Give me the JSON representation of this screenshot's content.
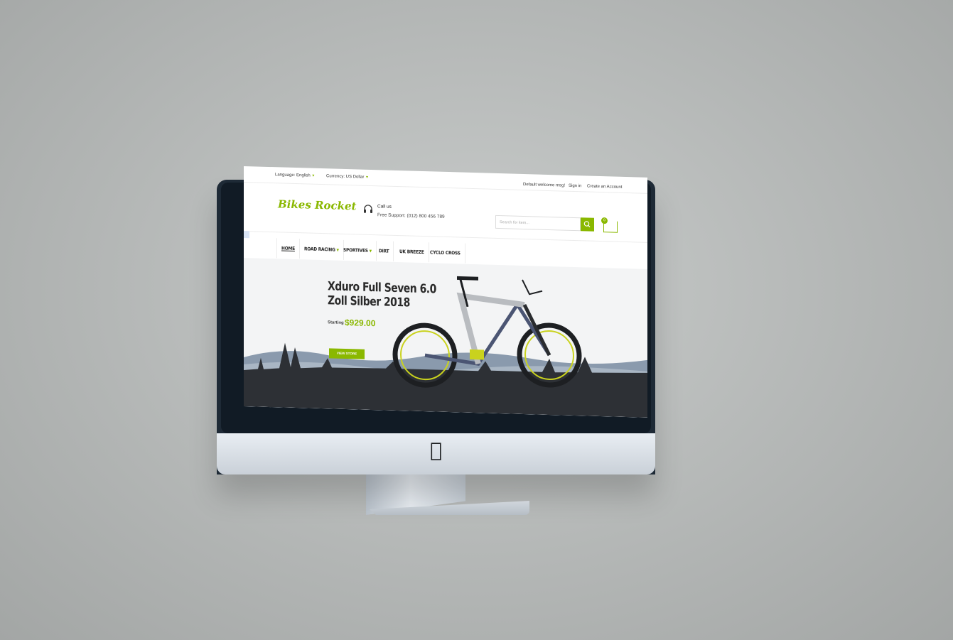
{
  "topbar": {
    "language": "Language: English",
    "currency": "Currency: US Dollar",
    "welcome": "Default welcome msg!",
    "signin": "Sign in",
    "create_account": "Create an Account"
  },
  "header": {
    "logo": "Bikes Rocket",
    "call_title": "Call us",
    "call_text": "Free Support: (012) 800 456 789",
    "search_placeholder": "Search for item...",
    "cart_count": "0"
  },
  "nav": {
    "items": [
      {
        "label": "HOME"
      },
      {
        "label": "ROAD RACING"
      },
      {
        "label": "SPORTIVES"
      },
      {
        "label": "DIRT"
      },
      {
        "label": "UK BREEZE"
      },
      {
        "label": "CYCLO CROSS"
      }
    ]
  },
  "banner": {
    "title_line1": "Xduro Full Seven 6.0",
    "title_line2": "Zoll Silber 2018",
    "price_label": "Starting",
    "price": "$929.00",
    "button": "VIEW STORE"
  },
  "colors": {
    "accent": "#8ab800",
    "background": "#b4b7b6",
    "monitor_bezel": "#1e2a36"
  },
  "icons": [
    "headset-icon",
    "search-icon",
    "cart-icon",
    "apple-logo-icon",
    "chevron-down-icon"
  ]
}
